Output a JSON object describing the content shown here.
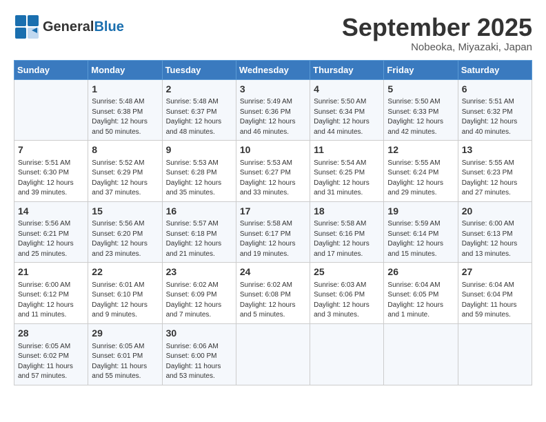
{
  "header": {
    "logo_line1": "General",
    "logo_line2": "Blue",
    "month": "September 2025",
    "location": "Nobeoka, Miyazaki, Japan"
  },
  "days_of_week": [
    "Sunday",
    "Monday",
    "Tuesday",
    "Wednesday",
    "Thursday",
    "Friday",
    "Saturday"
  ],
  "weeks": [
    [
      {
        "num": "",
        "info": ""
      },
      {
        "num": "1",
        "info": "Sunrise: 5:48 AM\nSunset: 6:38 PM\nDaylight: 12 hours\nand 50 minutes."
      },
      {
        "num": "2",
        "info": "Sunrise: 5:48 AM\nSunset: 6:37 PM\nDaylight: 12 hours\nand 48 minutes."
      },
      {
        "num": "3",
        "info": "Sunrise: 5:49 AM\nSunset: 6:36 PM\nDaylight: 12 hours\nand 46 minutes."
      },
      {
        "num": "4",
        "info": "Sunrise: 5:50 AM\nSunset: 6:34 PM\nDaylight: 12 hours\nand 44 minutes."
      },
      {
        "num": "5",
        "info": "Sunrise: 5:50 AM\nSunset: 6:33 PM\nDaylight: 12 hours\nand 42 minutes."
      },
      {
        "num": "6",
        "info": "Sunrise: 5:51 AM\nSunset: 6:32 PM\nDaylight: 12 hours\nand 40 minutes."
      }
    ],
    [
      {
        "num": "7",
        "info": "Sunrise: 5:51 AM\nSunset: 6:30 PM\nDaylight: 12 hours\nand 39 minutes."
      },
      {
        "num": "8",
        "info": "Sunrise: 5:52 AM\nSunset: 6:29 PM\nDaylight: 12 hours\nand 37 minutes."
      },
      {
        "num": "9",
        "info": "Sunrise: 5:53 AM\nSunset: 6:28 PM\nDaylight: 12 hours\nand 35 minutes."
      },
      {
        "num": "10",
        "info": "Sunrise: 5:53 AM\nSunset: 6:27 PM\nDaylight: 12 hours\nand 33 minutes."
      },
      {
        "num": "11",
        "info": "Sunrise: 5:54 AM\nSunset: 6:25 PM\nDaylight: 12 hours\nand 31 minutes."
      },
      {
        "num": "12",
        "info": "Sunrise: 5:55 AM\nSunset: 6:24 PM\nDaylight: 12 hours\nand 29 minutes."
      },
      {
        "num": "13",
        "info": "Sunrise: 5:55 AM\nSunset: 6:23 PM\nDaylight: 12 hours\nand 27 minutes."
      }
    ],
    [
      {
        "num": "14",
        "info": "Sunrise: 5:56 AM\nSunset: 6:21 PM\nDaylight: 12 hours\nand 25 minutes."
      },
      {
        "num": "15",
        "info": "Sunrise: 5:56 AM\nSunset: 6:20 PM\nDaylight: 12 hours\nand 23 minutes."
      },
      {
        "num": "16",
        "info": "Sunrise: 5:57 AM\nSunset: 6:18 PM\nDaylight: 12 hours\nand 21 minutes."
      },
      {
        "num": "17",
        "info": "Sunrise: 5:58 AM\nSunset: 6:17 PM\nDaylight: 12 hours\nand 19 minutes."
      },
      {
        "num": "18",
        "info": "Sunrise: 5:58 AM\nSunset: 6:16 PM\nDaylight: 12 hours\nand 17 minutes."
      },
      {
        "num": "19",
        "info": "Sunrise: 5:59 AM\nSunset: 6:14 PM\nDaylight: 12 hours\nand 15 minutes."
      },
      {
        "num": "20",
        "info": "Sunrise: 6:00 AM\nSunset: 6:13 PM\nDaylight: 12 hours\nand 13 minutes."
      }
    ],
    [
      {
        "num": "21",
        "info": "Sunrise: 6:00 AM\nSunset: 6:12 PM\nDaylight: 12 hours\nand 11 minutes."
      },
      {
        "num": "22",
        "info": "Sunrise: 6:01 AM\nSunset: 6:10 PM\nDaylight: 12 hours\nand 9 minutes."
      },
      {
        "num": "23",
        "info": "Sunrise: 6:02 AM\nSunset: 6:09 PM\nDaylight: 12 hours\nand 7 minutes."
      },
      {
        "num": "24",
        "info": "Sunrise: 6:02 AM\nSunset: 6:08 PM\nDaylight: 12 hours\nand 5 minutes."
      },
      {
        "num": "25",
        "info": "Sunrise: 6:03 AM\nSunset: 6:06 PM\nDaylight: 12 hours\nand 3 minutes."
      },
      {
        "num": "26",
        "info": "Sunrise: 6:04 AM\nSunset: 6:05 PM\nDaylight: 12 hours\nand 1 minute."
      },
      {
        "num": "27",
        "info": "Sunrise: 6:04 AM\nSunset: 6:04 PM\nDaylight: 11 hours\nand 59 minutes."
      }
    ],
    [
      {
        "num": "28",
        "info": "Sunrise: 6:05 AM\nSunset: 6:02 PM\nDaylight: 11 hours\nand 57 minutes."
      },
      {
        "num": "29",
        "info": "Sunrise: 6:05 AM\nSunset: 6:01 PM\nDaylight: 11 hours\nand 55 minutes."
      },
      {
        "num": "30",
        "info": "Sunrise: 6:06 AM\nSunset: 6:00 PM\nDaylight: 11 hours\nand 53 minutes."
      },
      {
        "num": "",
        "info": ""
      },
      {
        "num": "",
        "info": ""
      },
      {
        "num": "",
        "info": ""
      },
      {
        "num": "",
        "info": ""
      }
    ]
  ]
}
